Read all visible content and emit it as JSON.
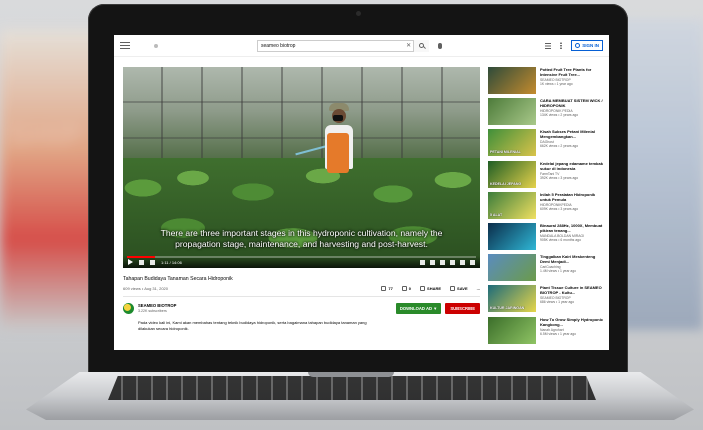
{
  "search": {
    "value": "seameo biotrop"
  },
  "header": {
    "signin_label": "SIGN IN"
  },
  "player": {
    "subtitle_line1": "There are three important stages in this hydroponic cultivation, namely the",
    "subtitle_line2": "propagation stage, maintenance, and harvesting and post-harvest.",
    "time": "1:11 / 14:06",
    "progress_fraction": 0.08
  },
  "video": {
    "title": "Tahapan Budidaya Tanaman Secara Hidroponik",
    "meta": "609 views • Aug 31, 2020",
    "likes": "77",
    "dislikes": "0",
    "share_label": "SHARE",
    "save_label": "SAVE",
    "more_label": "..."
  },
  "channel": {
    "name": "SEAMEO BIOTROP",
    "subscribers": "3.22K subscribers",
    "download_label": "DOWNLOAD AD ▼",
    "subscribe_label": "SUBSCRIBE",
    "description": "Pada video kali ini, Kami akan membahas tentang teknik budidaya hidroponik, serta bagaimana tahapan budidaya tanaman yang dilakukan secara hidroponik."
  },
  "recommendations": [
    {
      "title": "Potted Fruit Tree Plants for Intensive Fruit Tree...",
      "channel": "SEAMEO BIOTROP",
      "views": "1K views • 1 year ago",
      "thumb_text": "",
      "colors": [
        "#2e4b3a",
        "#c48b2e"
      ]
    },
    {
      "title": "CARA MEMBUAT SISTEM WICK / HIDROPONIK",
      "channel": "HIDROPONIK PEDIA",
      "views": "134K views • 2 years ago",
      "thumb_text": "",
      "colors": [
        "#4d7b3a",
        "#a9c98a"
      ]
    },
    {
      "title": "Kisah Sukses Petani Milenial Mengembangkan...",
      "channel": "DAGhost",
      "views": "662K views • 2 years ago",
      "thumb_text": "PETANI MILENIAL",
      "colors": [
        "#3f8f3a",
        "#d9c34a"
      ]
    },
    {
      "title": "Kedelai jepang edamame tembak sukur di indonesia",
      "channel": "FarmTani TV",
      "views": "392K views • 3 years ago",
      "thumb_text": "KEDELAI JEPANG",
      "colors": [
        "#1f5e25",
        "#e5d24b"
      ]
    },
    {
      "title": "Inilah 5 Peralatan Hidroponik untuk Pemula",
      "channel": "HIDROPONIKPEDIA",
      "views": "609K views • 3 years ago",
      "thumb_text": "5 ALAT",
      "colors": [
        "#3c7d3b",
        "#f0e061"
      ]
    },
    {
      "title": "Binaural 288Hz, 1000X, Membuat pikiran tenang...",
      "channel": "MANDALA BOLDAN MIRAGI",
      "views": "905K views • 6 months ago",
      "thumb_text": "",
      "colors": [
        "#0b2d4a",
        "#2fb7d6"
      ]
    },
    {
      "title": "Tinggalkan Kairi Meskenteng Demi Menjadi...",
      "channel": "CariCoaching",
      "views": "1.4M views • 1 year ago",
      "thumb_text": "",
      "colors": [
        "#5a8cbf",
        "#6b9b4a"
      ]
    },
    {
      "title": "Plant Tissue Culture in SEAMEO BIOTROP - Kultu...",
      "channel": "SEAMEO BIOTROP",
      "views": "686 views • 1 year ago",
      "thumb_text": "KULTUR JARINGAN",
      "colors": [
        "#1c6b7a",
        "#e6d64a"
      ]
    },
    {
      "title": "How To Grow Simply Hydroponic Kangkong...",
      "channel": "Nanah Agrohart",
      "views": "6.5M views • 1 year ago",
      "thumb_text": "",
      "colors": [
        "#3b6e2a",
        "#8fc464"
      ]
    }
  ]
}
